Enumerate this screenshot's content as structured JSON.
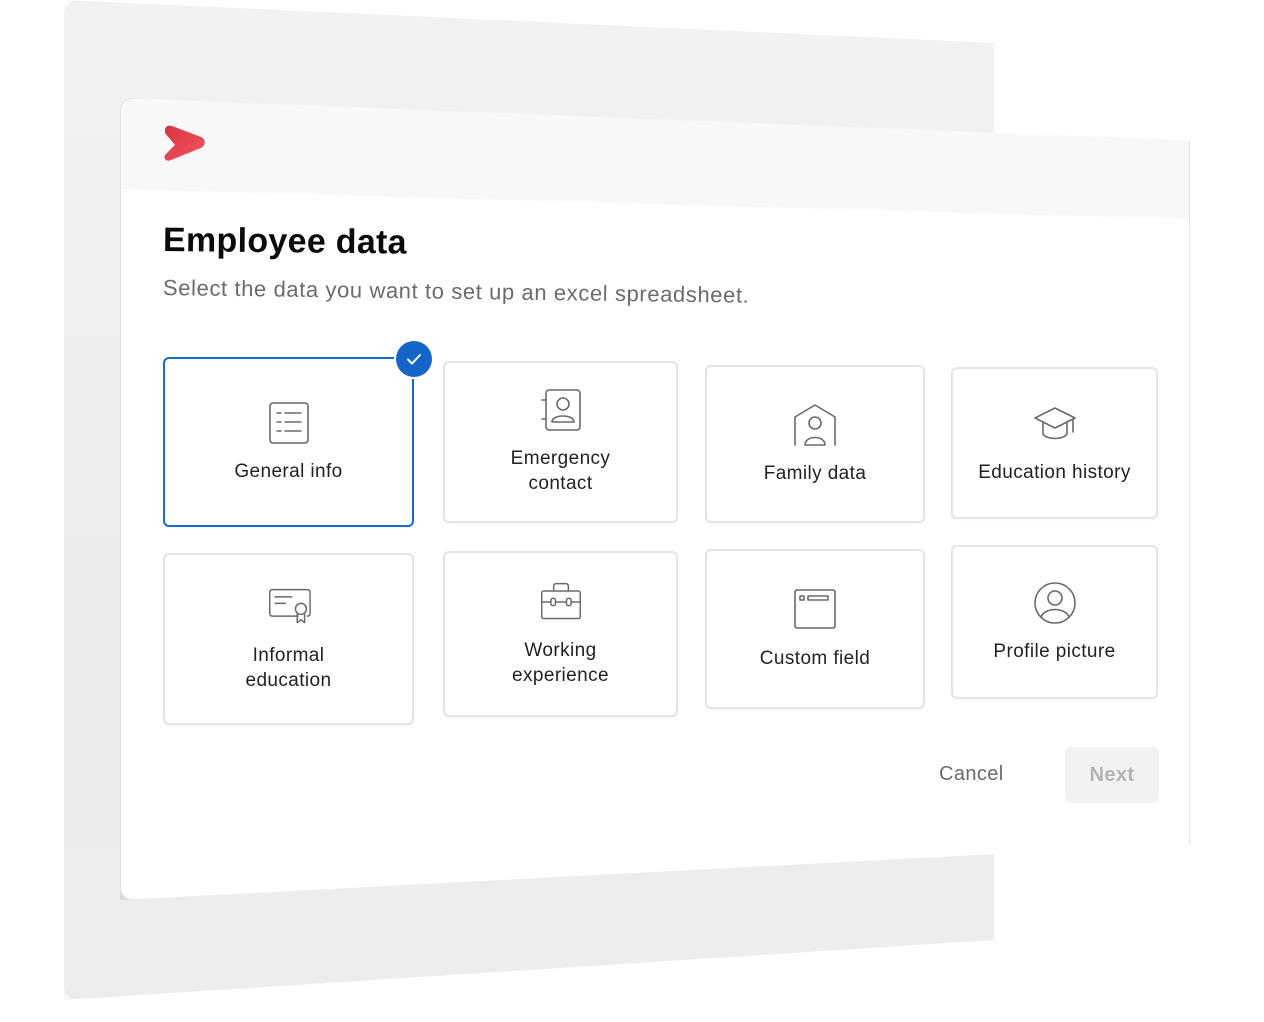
{
  "brand": {
    "logo_icon": "chevron-play-logo",
    "logo_color": "#e2424e"
  },
  "dialog": {
    "title": "Employee data",
    "subtitle": "Select the data you want to set up an excel spreadsheet."
  },
  "options": [
    {
      "label": "General info",
      "icon": "list-document-icon",
      "selected": true
    },
    {
      "label": "Emergency\ncontact",
      "icon": "contact-book-icon",
      "selected": false
    },
    {
      "label": "Family data",
      "icon": "house-person-icon",
      "selected": false
    },
    {
      "label": "Education history",
      "icon": "graduation-cap-icon",
      "selected": false
    },
    {
      "label": "Informal\neducation",
      "icon": "certificate-icon",
      "selected": false
    },
    {
      "label": "Working\nexperience",
      "icon": "briefcase-icon",
      "selected": false
    },
    {
      "label": "Custom field",
      "icon": "window-field-icon",
      "selected": false
    },
    {
      "label": "Profile picture",
      "icon": "user-circle-icon",
      "selected": false
    }
  ],
  "selected_badge_icon": "check-icon",
  "actions": {
    "cancel_label": "Cancel",
    "next_label": "Next",
    "next_disabled": true
  },
  "colors": {
    "accent": "#1565c8",
    "selected_border": "#1a6ad6",
    "tile_border": "#e4e4e6",
    "disabled_text": "#b3b3b3",
    "disabled_bg": "#f2f2f3"
  }
}
